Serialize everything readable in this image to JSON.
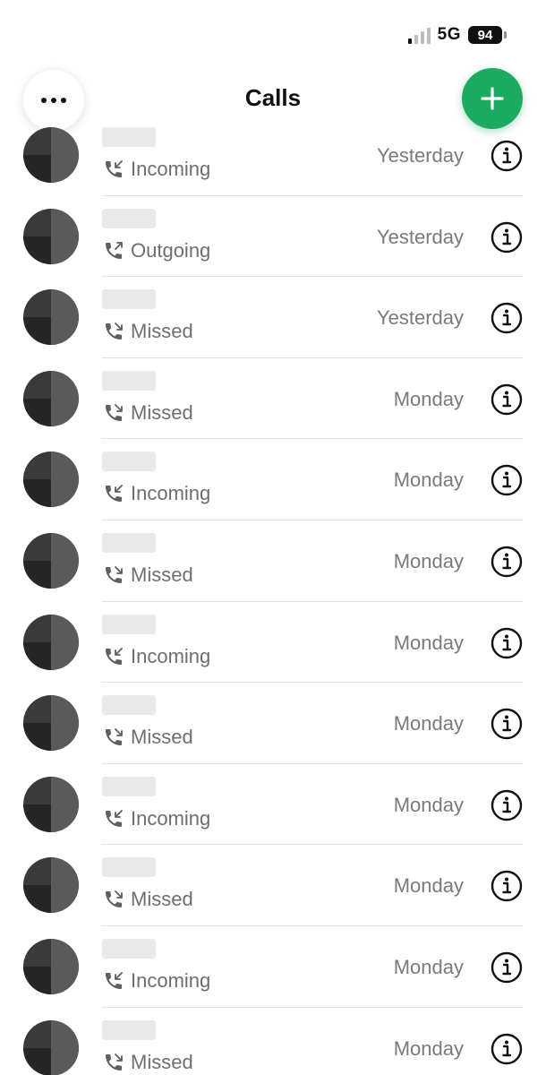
{
  "status_bar": {
    "network": "5G",
    "battery": "94",
    "signal_bars_active": 1,
    "signal_bars_total": 4
  },
  "header": {
    "title": "Calls",
    "menu_icon": "ellipsis-icon",
    "add_icon": "plus-icon"
  },
  "colors": {
    "accent": "#1daa61",
    "text_secondary": "#6e6e6e"
  },
  "calls": [
    {
      "type": "Incoming",
      "when": "Yesterday",
      "icon": "incoming-call-icon"
    },
    {
      "type": "Outgoing",
      "when": "Yesterday",
      "icon": "outgoing-call-icon"
    },
    {
      "type": "Missed",
      "when": "Yesterday",
      "icon": "missed-call-icon"
    },
    {
      "type": "Missed",
      "when": "Monday",
      "icon": "missed-call-icon"
    },
    {
      "type": "Incoming",
      "when": "Monday",
      "icon": "incoming-call-icon"
    },
    {
      "type": "Missed",
      "when": "Monday",
      "icon": "missed-call-icon"
    },
    {
      "type": "Incoming",
      "when": "Monday",
      "icon": "incoming-call-icon"
    },
    {
      "type": "Missed",
      "when": "Monday",
      "icon": "missed-call-icon"
    },
    {
      "type": "Incoming",
      "when": "Monday",
      "icon": "incoming-call-icon"
    },
    {
      "type": "Missed",
      "when": "Monday",
      "icon": "missed-call-icon"
    },
    {
      "type": "Incoming",
      "when": "Monday",
      "icon": "incoming-call-icon"
    },
    {
      "type": "Missed",
      "when": "Monday",
      "icon": "missed-call-icon"
    }
  ]
}
